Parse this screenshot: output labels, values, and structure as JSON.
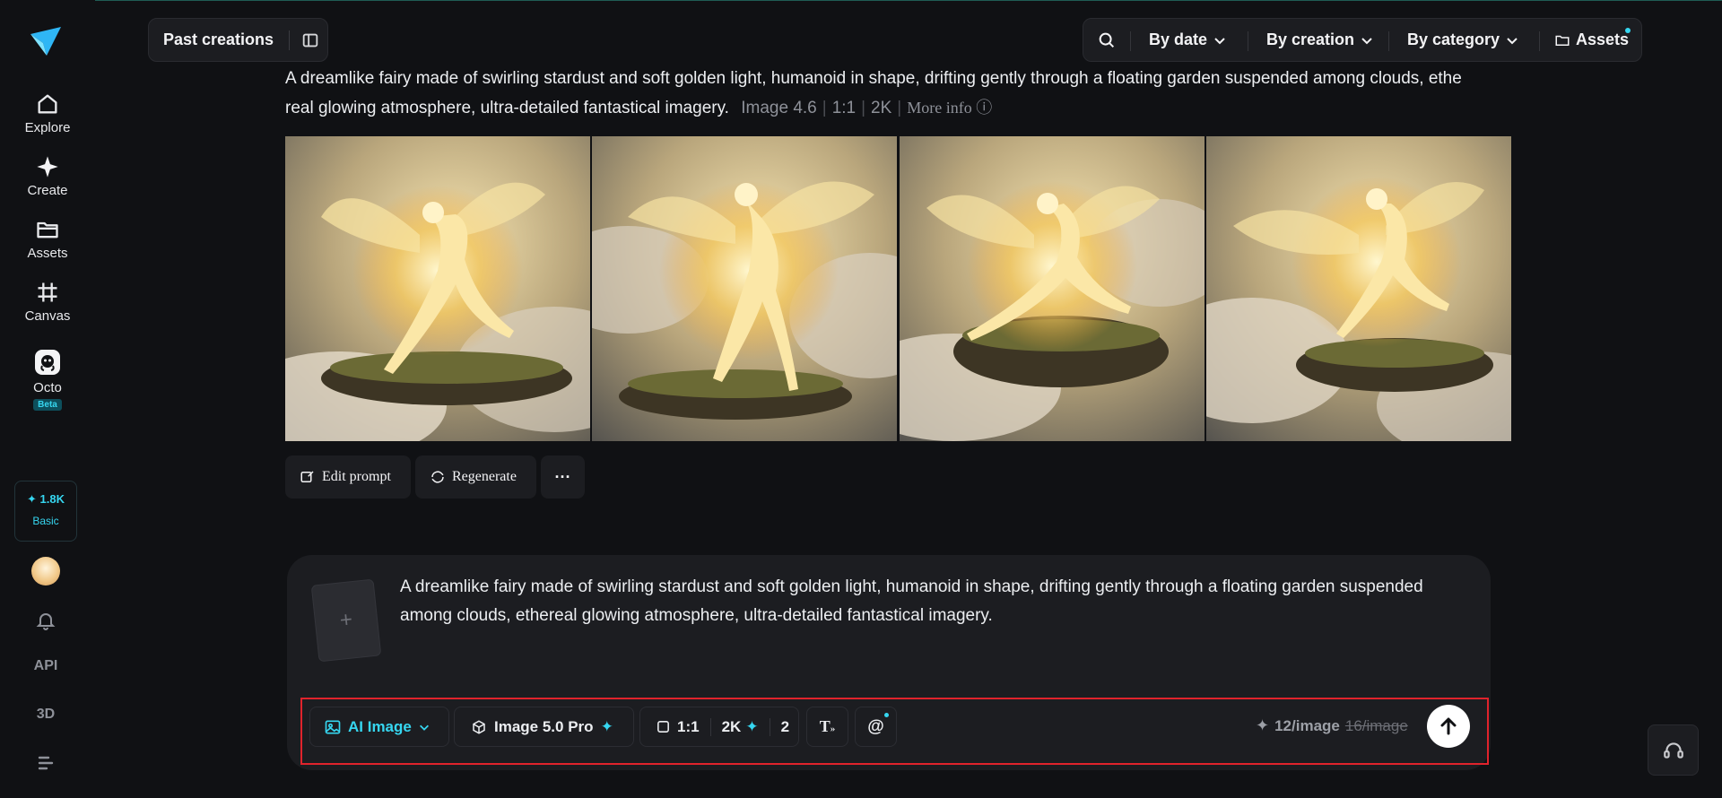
{
  "sidebar": {
    "items": [
      {
        "label": "Explore",
        "icon": "home-icon"
      },
      {
        "label": "Create",
        "icon": "sparkle-icon"
      },
      {
        "label": "Assets",
        "icon": "folder-icon"
      },
      {
        "label": "Canvas",
        "icon": "canvas-icon"
      },
      {
        "label": "Octo",
        "icon": "octo-icon",
        "badge": "Beta"
      }
    ],
    "credits": {
      "amount": "1.8K",
      "plan": "Basic"
    },
    "api_label": "API",
    "threed_label": "3D"
  },
  "header": {
    "past_creations": "Past creations",
    "filters": [
      "By date",
      "By creation",
      "By category"
    ],
    "assets_label": "Assets"
  },
  "generation": {
    "prompt_line1": "A dreamlike fairy made of swirling stardust and soft golden light, humanoid in shape, drifting gently through a floating garden suspended among clouds, ethe",
    "prompt_line2": "real glowing atmosphere, ultra-detailed fantastical imagery.",
    "model": "Image 4.6",
    "ratio": "1:1",
    "resolution": "2K",
    "more_info": "More info",
    "actions": {
      "edit": "Edit prompt",
      "regenerate": "Regenerate"
    }
  },
  "composer": {
    "prompt_line1": "A dreamlike fairy made of swirling stardust and soft golden light, humanoid in shape, drifting gently through a floating garden suspended",
    "prompt_line2": "among clouds, ethereal glowing atmosphere, ultra-detailed fantastical imagery.",
    "mode": "AI Image",
    "model": "Image 5.0 Pro",
    "ratio": "1:1",
    "resolution": "2K",
    "count": "2",
    "cost": "12/image",
    "cost_old": "16/image"
  },
  "colors": {
    "accent": "#36d6f0",
    "highlight": "#e0232c",
    "background": "#101114",
    "panel": "#1c1d21"
  }
}
